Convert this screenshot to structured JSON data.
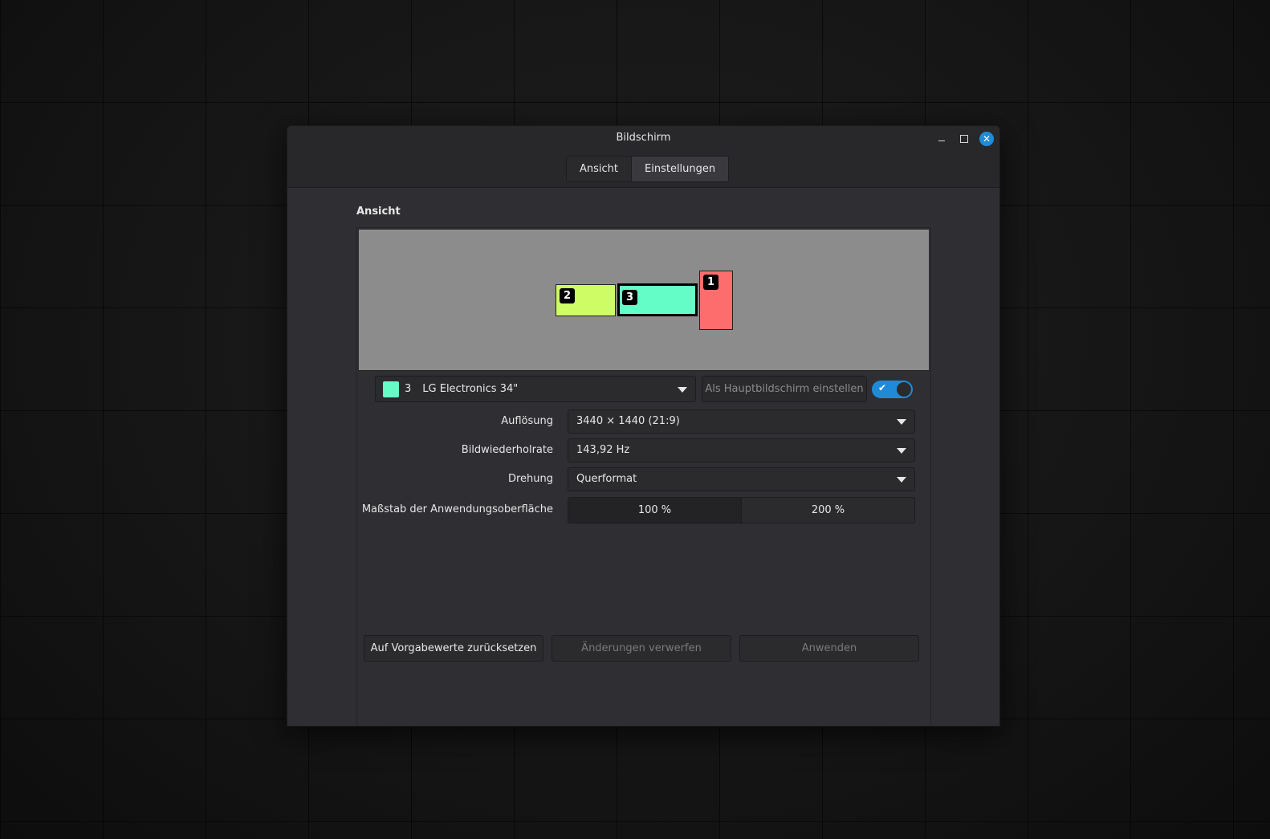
{
  "window": {
    "title": "Bildschirm"
  },
  "tabs": [
    {
      "label": "Ansicht",
      "active": false
    },
    {
      "label": "Einstellungen",
      "active": true
    }
  ],
  "section": {
    "title": "Ansicht"
  },
  "monitors": [
    {
      "id": "2",
      "color": "#cdfc65"
    },
    {
      "id": "3",
      "color": "#64fdc8",
      "selected": true
    },
    {
      "id": "1",
      "color": "#fe6d6d"
    }
  ],
  "monitor_select": {
    "id": "3",
    "name": "LG Electronics 34\""
  },
  "primary_button": {
    "label": "Als Hauptbildschirm einstellen"
  },
  "enabled_toggle": {
    "on": true,
    "check": "✔"
  },
  "fields": {
    "resolution": {
      "label": "Auflösung",
      "value": "3440 × 1440 (21:9)"
    },
    "refresh": {
      "label": "Bildwiederholrate",
      "value": "143,92 Hz"
    },
    "rotation": {
      "label": "Drehung",
      "value": "Querformat"
    },
    "scale": {
      "label": "Maßstab der Anwendungsoberfläche",
      "options": [
        "100 %",
        "200 %"
      ],
      "selected": "100 %"
    }
  },
  "footer": {
    "reset": "Auf Vorgabewerte zurücksetzen",
    "discard": "Änderungen verwerfen",
    "apply": "Anwenden"
  },
  "colors": {
    "accent": "#1f8bd8"
  }
}
